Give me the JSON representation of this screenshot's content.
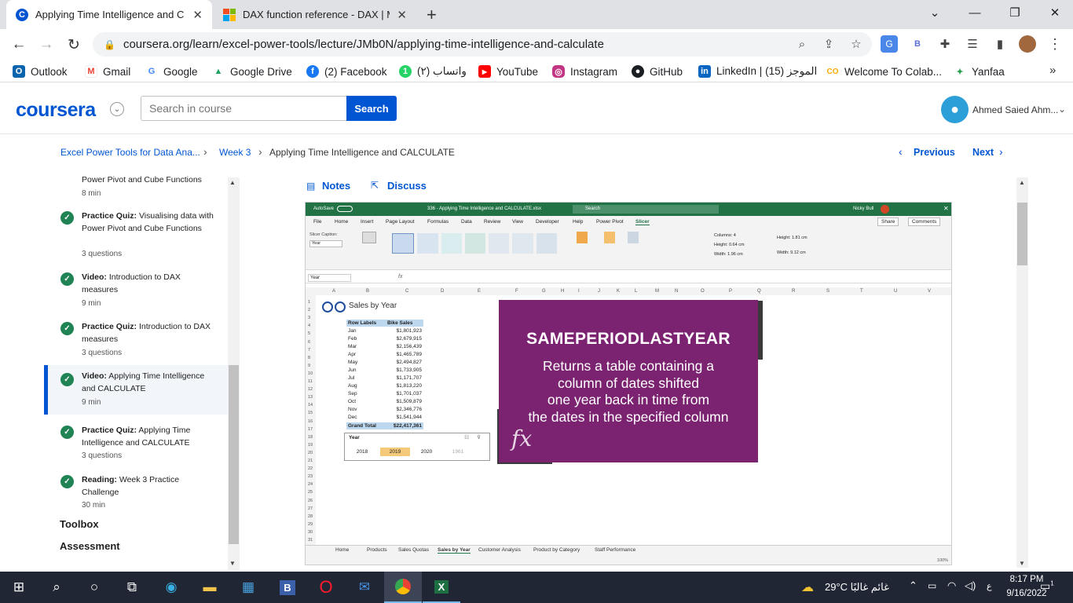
{
  "browser": {
    "tabs": [
      {
        "title": "Applying Time Intelligence and C",
        "active": true
      },
      {
        "title": "DAX function reference - DAX | M",
        "active": false
      }
    ],
    "url": "coursera.org/learn/excel-power-tools/lecture/JMb0N/applying-time-intelligence-and-calculate",
    "bookmarks": [
      {
        "label": "Outlook",
        "icon": "outlook-icon",
        "color": "#0a64ad"
      },
      {
        "label": "Gmail",
        "icon": "gmail-icon",
        "color": "#ea4335"
      },
      {
        "label": "Google",
        "icon": "google-icon",
        "color": "#4285f4"
      },
      {
        "label": "Google Drive",
        "icon": "drive-icon",
        "color": "#1fa463"
      },
      {
        "label": "(2) Facebook",
        "icon": "facebook-icon",
        "color": "#1877f2"
      },
      {
        "label": "واتساب (٢)",
        "icon": "whatsapp-icon",
        "color": "#25d366"
      },
      {
        "label": "YouTube",
        "icon": "youtube-icon",
        "color": "#ff0000"
      },
      {
        "label": "Instagram",
        "icon": "instagram-icon",
        "color": "#c13584"
      },
      {
        "label": "GitHub",
        "icon": "github-icon",
        "color": "#1b1f23"
      },
      {
        "label": "LinkedIn | الموجز (15)",
        "icon": "linkedin-icon",
        "color": "#0a66c2"
      },
      {
        "label": "Welcome To Colab...",
        "icon": "colab-icon",
        "color": "#f9ab00"
      },
      {
        "label": "Yanfaa",
        "icon": "yanfaa-icon",
        "color": "#2e9d4f"
      }
    ]
  },
  "header": {
    "logo": "coursera",
    "search_placeholder": "Search in course",
    "search_button": "Search",
    "user_name": "Ahmed Saied Ahm..."
  },
  "breadcrumb": {
    "course": "Excel Power Tools for Data Ana...",
    "week": "Week 3",
    "lesson": "Applying Time Intelligence and CALCULATE",
    "previous": "Previous",
    "next": "Next"
  },
  "sidebar": {
    "top_item": {
      "title": "Power Pivot and Cube Functions",
      "meta": "8 min"
    },
    "items": [
      {
        "kind": "Practice Quiz:",
        "title": "Visualising data with Power Pivot and Cube Functions",
        "meta": "3 questions"
      },
      {
        "kind": "Video:",
        "title": "Introduction to DAX measures",
        "meta": "9 min"
      },
      {
        "kind": "Practice Quiz:",
        "title": "Introduction to DAX measures",
        "meta": "3 questions"
      },
      {
        "kind": "Video:",
        "title": "Applying Time Intelligence and CALCULATE",
        "meta": "9 min"
      },
      {
        "kind": "Practice Quiz:",
        "title": "Applying Time Intelligence and CALCULATE",
        "meta": "3 questions"
      },
      {
        "kind": "Reading:",
        "title": "Week 3 Practice Challenge",
        "meta": "30 min"
      }
    ],
    "sections": [
      "Toolbox",
      "Assessment"
    ]
  },
  "content": {
    "notes": "Notes",
    "discuss": "Discuss"
  },
  "excel": {
    "title": "336 - Applying Time Intelligence and CALCULATE.xlsx",
    "autosave": "AutoSave",
    "search": "Search",
    "user": "Nicky Bull",
    "menu": [
      "File",
      "Home",
      "Insert",
      "Page Layout",
      "Formulas",
      "Data",
      "Review",
      "View",
      "Developer",
      "Help",
      "Power Pivot",
      "Slicer"
    ],
    "share": "Share",
    "comments": "Comments",
    "name_box": "Year",
    "sheet_title": "Sales by Year",
    "table_headers": [
      "Row Labels",
      "Bike Sales"
    ],
    "table_rows": [
      [
        "Jan",
        "$1,801,923"
      ],
      [
        "Feb",
        "$2,679,915"
      ],
      [
        "Mar",
        "$2,156,439"
      ],
      [
        "Apr",
        "$1,465,789"
      ],
      [
        "May",
        "$2,494,827"
      ],
      [
        "Jun",
        "$1,733,905"
      ],
      [
        "Jul",
        "$1,171,707"
      ],
      [
        "Aug",
        "$1,813,220"
      ],
      [
        "Sep",
        "$1,701,037"
      ],
      [
        "Oct",
        "$1,509,879"
      ],
      [
        "Nov",
        "$2,346,776"
      ],
      [
        "Dec",
        "$1,541,944"
      ]
    ],
    "grand_total": [
      "Grand Total",
      "$22,417,361"
    ],
    "slicer_title": "Year",
    "slicer_years": [
      "2018",
      "2019",
      "2020",
      "1961"
    ],
    "sheet_tabs": [
      "Home",
      "Products",
      "Sales Quotas",
      "Sales by Year",
      "Customer Analysis",
      "Product by Category",
      "Staff Performance"
    ],
    "active_tab": "Sales by Year",
    "ribbon": {
      "slicer_caption": "Slicer Caption:",
      "caption_value": "Year",
      "columns_label": "Columns:",
      "columns_value": "4",
      "height_label": "Height:",
      "height_value": "0.64 cm",
      "width_label": "Width:",
      "width_value": "1.96 cm",
      "size_height": "1.81 cm",
      "size_width": "9.12 cm"
    },
    "zoom": "100%"
  },
  "overlay": {
    "title": "SAMEPERIODLASTYEAR",
    "body": [
      "Returns a table containing a",
      "column of dates shifted",
      "one year back in time from",
      "the dates in the specified column"
    ],
    "fx": "fx"
  },
  "taskbar": {
    "weather": "29°C  غائم غالبًا",
    "time": "8:17 PM",
    "date": "9/16/2022",
    "notifications": "1"
  }
}
